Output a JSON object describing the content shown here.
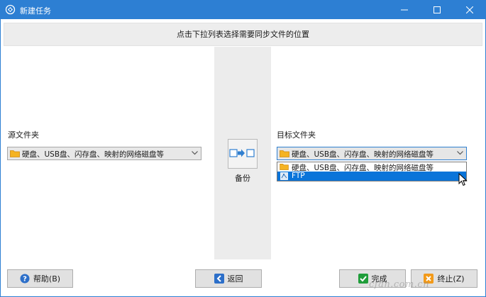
{
  "window": {
    "title": "新建任务"
  },
  "instruction": "点击下拉列表选择需要同步文件的位置",
  "source": {
    "label": "源文件夹",
    "selected": "硬盘、USB盘、闪存盘、映射的网络磁盘等"
  },
  "target": {
    "label": "目标文件夹",
    "selected": "硬盘、USB盘、闪存盘、映射的网络磁盘等",
    "options": [
      {
        "label": "硬盘、USB盘、闪存盘、映射的网络磁盘等",
        "icon": "folder-icon"
      },
      {
        "label": "FTP",
        "icon": "ftp-icon"
      }
    ]
  },
  "action": {
    "label": "备份"
  },
  "buttons": {
    "help": "帮助(B)",
    "back": "返回",
    "finish": "完成",
    "cancel": "终止(Z)"
  },
  "watermark": "cfan.com.cn",
  "colors": {
    "titlebar": "#2d7fd3",
    "selection": "#0a74d9",
    "accent_green": "#1f9d3a",
    "accent_orange": "#f29a1a"
  }
}
